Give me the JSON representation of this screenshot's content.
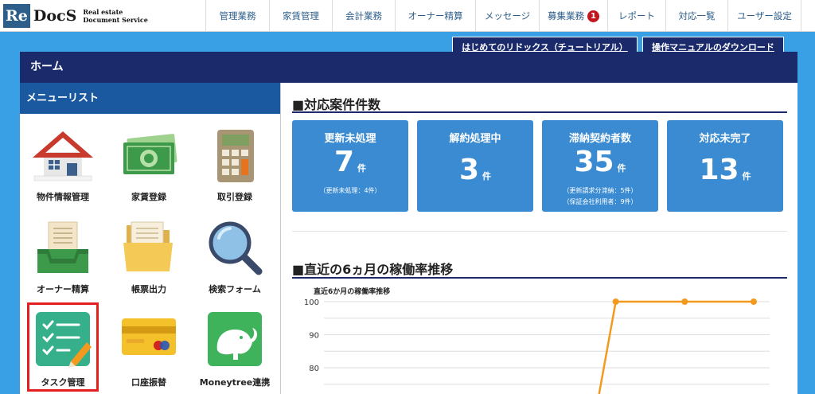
{
  "logo": {
    "re": "Re",
    "docs": "DocS",
    "sub_line1": "Real estate",
    "sub_line2": "Document Service"
  },
  "nav": [
    {
      "label": "管理業務"
    },
    {
      "label": "家賃管理"
    },
    {
      "label": "会計業務"
    },
    {
      "label": "オーナー精算"
    },
    {
      "label": "メッセージ"
    },
    {
      "label": "募集業務",
      "badge": "1"
    },
    {
      "label": "レポート"
    },
    {
      "label": "対応一覧"
    },
    {
      "label": "ユーザー設定"
    }
  ],
  "tabs": {
    "tutorial": "はじめてのリドックス（チュートリアル）",
    "manual": "操作マニュアルのダウンロード"
  },
  "home": {
    "title": "ホーム"
  },
  "menu": {
    "title": "メニューリスト",
    "items": [
      {
        "label": "物件情報管理",
        "icon": "house-icon"
      },
      {
        "label": "家賃登録",
        "icon": "money-icon"
      },
      {
        "label": "取引登録",
        "icon": "calculator-icon"
      },
      {
        "label": "オーナー精算",
        "icon": "document-tray-icon"
      },
      {
        "label": "帳票出力",
        "icon": "folder-icon"
      },
      {
        "label": "検索フォーム",
        "icon": "magnifier-icon"
      },
      {
        "label": "タスク管理",
        "icon": "checklist-icon"
      },
      {
        "label": "口座振替",
        "icon": "credit-card-icon"
      },
      {
        "label": "Moneytree連携",
        "icon": "moneytree-icon"
      }
    ]
  },
  "cases": {
    "title": "■対応案件件数",
    "cards": [
      {
        "title": "更新未処理",
        "value": "7",
        "unit": "件",
        "sub1": "（更新未処理：4件）",
        "sub2": ""
      },
      {
        "title": "解約処理中",
        "value": "3",
        "unit": "件",
        "sub1": "",
        "sub2": ""
      },
      {
        "title": "滞納契約者数",
        "value": "35",
        "unit": "件",
        "sub1": "（更新請求分滞納：5件）",
        "sub2": "（保証会社利用者：9件）"
      },
      {
        "title": "対応未完了",
        "value": "13",
        "unit": "件",
        "sub1": "",
        "sub2": ""
      }
    ]
  },
  "trend": {
    "title": "■直近の6ヵ月の稼働率推移"
  },
  "chart_data": {
    "type": "line",
    "title": "直近6か月の稼働率推移",
    "yticks": [
      "100",
      "90",
      "80"
    ],
    "ylim": [
      73,
      100
    ],
    "series": [
      {
        "values": [
          null,
          null,
          null,
          null,
          100,
          100,
          100
        ]
      }
    ],
    "colors": {
      "line": "#f39a1e",
      "grid": "#dddddd"
    },
    "grid": true
  }
}
